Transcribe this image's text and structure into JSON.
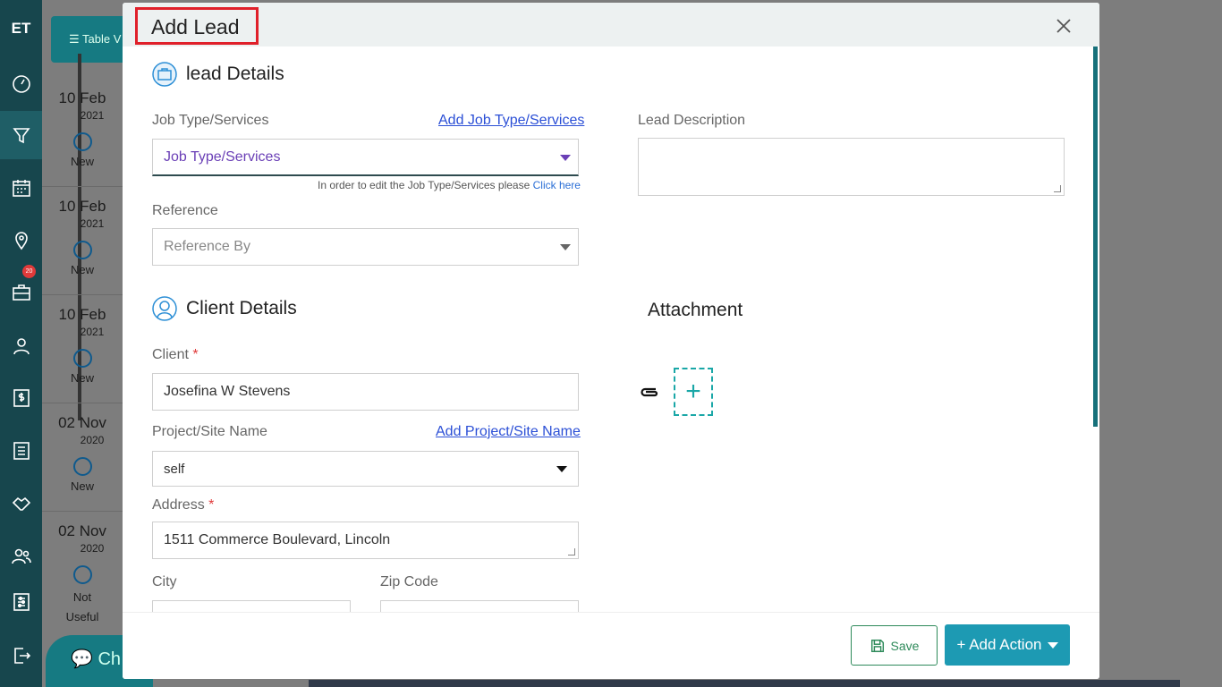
{
  "app": {
    "logo": "ET"
  },
  "nav": {
    "badge_count": "20",
    "items": [
      "dashboard-icon",
      "funnel-icon",
      "calendar-icon",
      "map-pin-icon",
      "briefcase-icon",
      "user-icon",
      "dollar-icon",
      "list-icon",
      "handshake-icon",
      "team-icon",
      "settings-sliders-icon",
      "logout-icon"
    ]
  },
  "background": {
    "view_button": "Table V",
    "timeline": [
      {
        "date": "10 Feb",
        "year": "2021",
        "status": "New"
      },
      {
        "date": "10 Feb",
        "year": "2021",
        "status": "New"
      },
      {
        "date": "10 Feb",
        "year": "2021",
        "status": "New"
      },
      {
        "date": "02 Nov",
        "year": "2020",
        "status": "New"
      },
      {
        "date": "02 Nov",
        "year": "2020",
        "status": "Not Useful"
      }
    ],
    "chat_label": "Ch"
  },
  "modal": {
    "title": "Add Lead",
    "lead_section": "lead Details",
    "job_type_label": "Job Type/Services",
    "add_job_type_link": "Add Job Type/Services",
    "job_type_value": "Job Type/Services",
    "job_type_hint": "In order to edit the Job Type/Services please",
    "job_type_hint_link": "Click here",
    "reference_label": "Reference",
    "reference_value": "Reference By",
    "lead_description_label": "Lead Description",
    "lead_description_value": "",
    "client_section": "Client Details",
    "client_label": "Client",
    "client_value": "Josefina W Stevens",
    "project_label": "Project/Site Name",
    "add_project_link": "Add Project/Site Name",
    "project_value": "self",
    "address_label": "Address",
    "address_value": "1511  Commerce Boulevard, Lincoln",
    "city_label": "City",
    "zip_label": "Zip Code",
    "required_mark": "*",
    "attachment_section": "Attachment",
    "attachment_add": "+",
    "save_button": "Save",
    "add_action_button": "+ Add Action"
  }
}
